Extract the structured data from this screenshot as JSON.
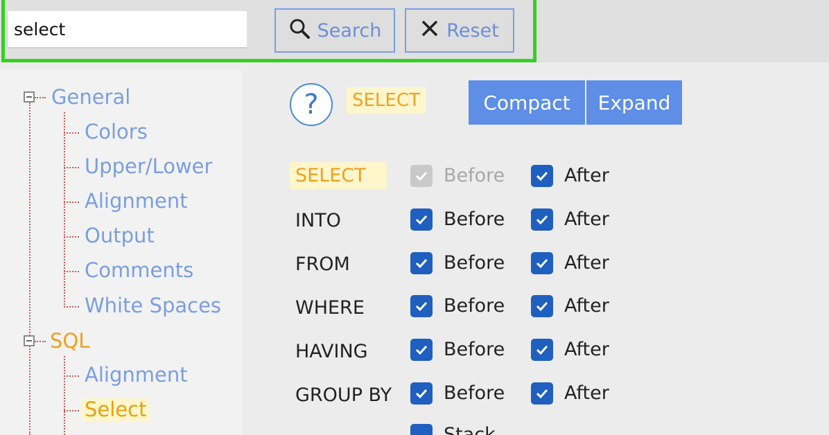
{
  "search": {
    "value": "select"
  },
  "buttons": {
    "search_label": "Search",
    "reset_label": "Reset"
  },
  "tree": {
    "groups": [
      {
        "label": "General",
        "items": [
          "Colors",
          "Upper/Lower",
          "Alignment",
          "Output",
          "Comments",
          "White Spaces"
        ]
      },
      {
        "label": "SQL",
        "items": [
          "Alignment",
          "Select"
        ]
      }
    ]
  },
  "panel": {
    "title": "SELECT",
    "view_buttons": [
      "Compact",
      "Expand"
    ],
    "rows": [
      {
        "label": "SELECT",
        "before": "Before",
        "after": "After",
        "before_checked": true,
        "before_enabled": false,
        "after_checked": true
      },
      {
        "label": "INTO",
        "before": "Before",
        "after": "After",
        "before_checked": true,
        "before_enabled": true,
        "after_checked": true
      },
      {
        "label": "FROM",
        "before": "Before",
        "after": "After",
        "before_checked": true,
        "before_enabled": true,
        "after_checked": true
      },
      {
        "label": "WHERE",
        "before": "Before",
        "after": "After",
        "before_checked": true,
        "before_enabled": true,
        "after_checked": true
      },
      {
        "label": "HAVING",
        "before": "Before",
        "after": "After",
        "before_checked": true,
        "before_enabled": true,
        "after_checked": true
      },
      {
        "label": "GROUP BY",
        "before": "Before",
        "after": "After",
        "before_checked": true,
        "before_enabled": true,
        "after_checked": true
      }
    ],
    "partial_option": {
      "label": "Stack",
      "checked": true
    }
  },
  "colors": {
    "highlight_border": "#32d21e",
    "accent": "#1f5fbf",
    "button_blue": "#5e8ee6"
  }
}
